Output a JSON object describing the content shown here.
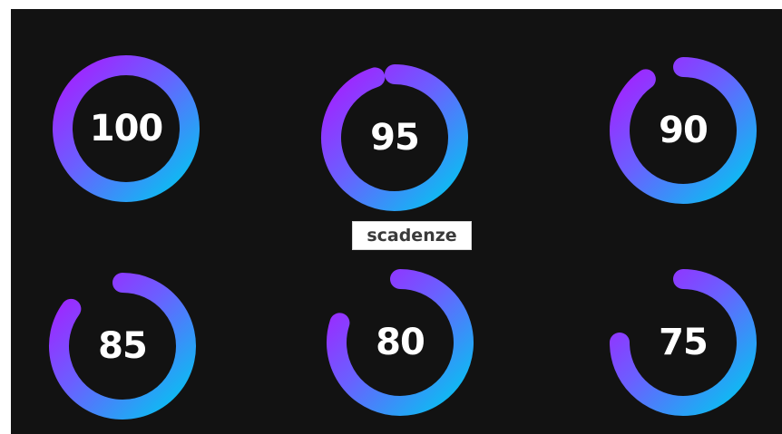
{
  "gauges": [
    {
      "value_label": "100",
      "value": 100
    },
    {
      "value_label": "95",
      "value": 95
    },
    {
      "value_label": "90",
      "value": 90
    },
    {
      "value_label": "85",
      "value": 85
    },
    {
      "value_label": "80",
      "value": 80
    },
    {
      "value_label": "75",
      "value": 75
    }
  ],
  "tooltip": {
    "label": "scadenze"
  },
  "colors": {
    "background": "#121212",
    "gradient_start": "#a81cff",
    "gradient_mid": "#6a60ff",
    "gradient_end": "#00c8f0",
    "text": "#ffffff",
    "tooltip_bg": "#ffffff",
    "tooltip_text": "#3a3a3a"
  }
}
